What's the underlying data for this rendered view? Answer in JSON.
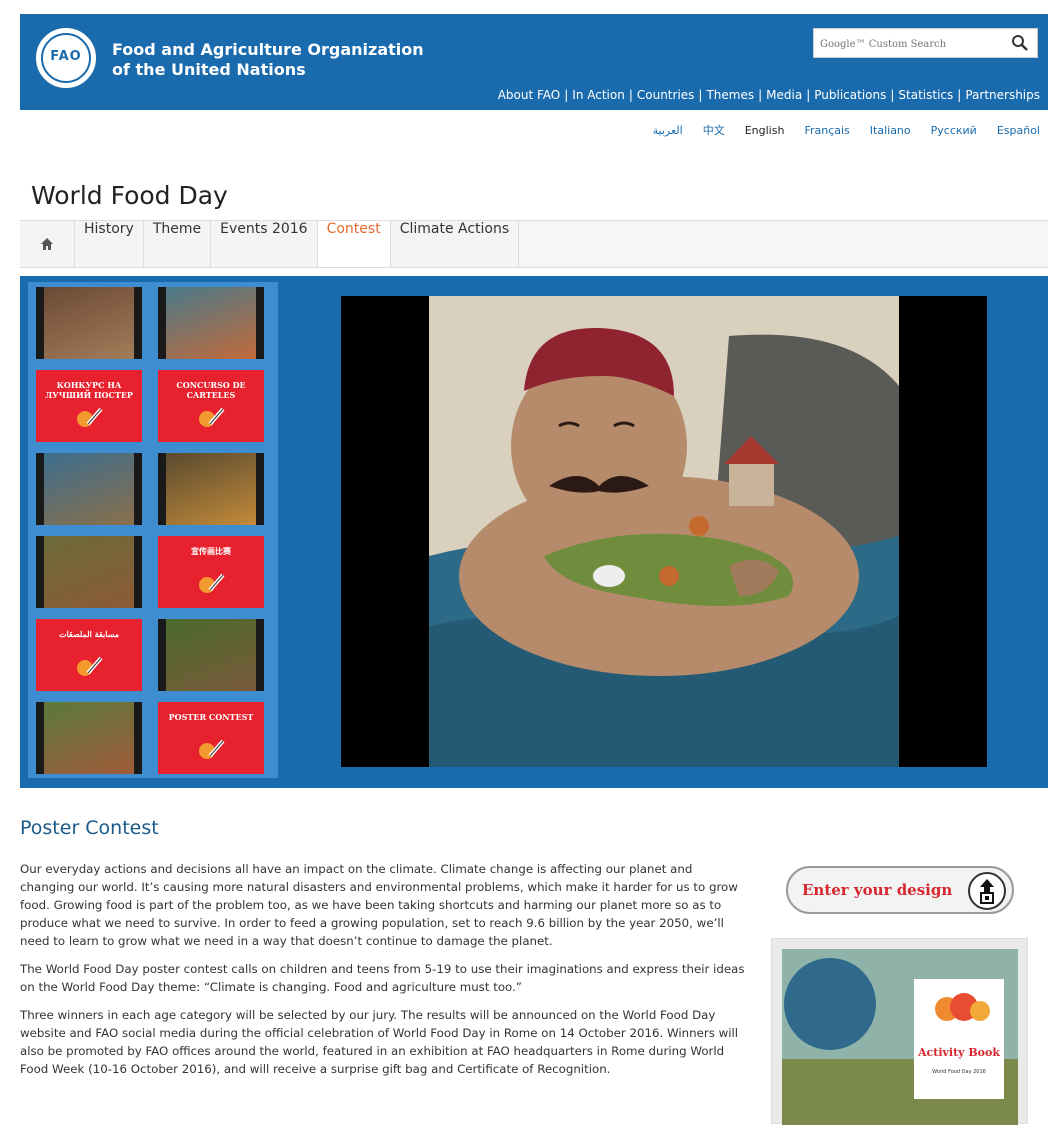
{
  "header": {
    "logo_text": "FAO",
    "org_line1": "Food and Agriculture Organization",
    "org_line2": "of the United Nations",
    "search_placeholder": "Google™ Custom Search",
    "nav": [
      "About FAO",
      "In Action",
      "Countries",
      "Themes",
      "Media",
      "Publications",
      "Statistics",
      "Partnerships"
    ]
  },
  "languages": [
    {
      "label": "العربية",
      "active": false
    },
    {
      "label": "中文",
      "active": false
    },
    {
      "label": "English",
      "active": true
    },
    {
      "label": "Français",
      "active": false
    },
    {
      "label": "Italiano",
      "active": false
    },
    {
      "label": "Русский",
      "active": false
    },
    {
      "label": "Español",
      "active": false
    }
  ],
  "page_title": "World Food Day",
  "subnav": {
    "home_icon": "home-icon",
    "tabs": [
      {
        "label": "History",
        "active": false
      },
      {
        "label": "Theme",
        "active": false
      },
      {
        "label": "Events 2016",
        "active": false
      },
      {
        "label": "Contest",
        "active": true
      },
      {
        "label": "Climate Actions",
        "active": false
      }
    ]
  },
  "gallery": {
    "thumbs": [
      {
        "type": "image"
      },
      {
        "type": "image"
      },
      {
        "type": "red",
        "label": "КОНКУРС НА ЛУЧШИЙ ПОСТЕР"
      },
      {
        "type": "red",
        "label": "CONCURSO DE CARTELES"
      },
      {
        "type": "image"
      },
      {
        "type": "image"
      },
      {
        "type": "image"
      },
      {
        "type": "red",
        "label": "宣传画比赛"
      },
      {
        "type": "red",
        "label": "مسابقة الملصقات"
      },
      {
        "type": "image"
      },
      {
        "type": "image"
      },
      {
        "type": "red",
        "label": "POSTER CONTEST"
      }
    ]
  },
  "section_title": "Poster Contest",
  "paragraphs": [
    "Our everyday actions and decisions all have an impact on the climate. Climate change is affecting our planet and changing our world. It’s causing more natural disasters and environmental problems, which make it harder for us to grow food. Growing food is part of the problem too, as we have been taking shortcuts and harming our planet more so as to produce what we need to survive. In order to feed a growing population, set to reach 9.6 billion by the year 2050, we’ll need to learn to grow what we need in a way that doesn’t continue to damage the planet.",
    "The World Food Day poster contest calls on children and teens from 5-19 to use their imaginations and express their ideas on the World Food Day theme: “Climate is changing. Food and agriculture must too.”",
    "Three winners in each age category will be selected by our jury. The results will be announced on the World Food Day website and FAO social media during the official celebration of World Food Day in Rome on 14 October 2016. Winners will also be promoted by FAO offices around the world, featured in an exhibition at FAO headquarters in Rome during World Food Week (10-16 October 2016), and will receive a surprise gift bag and Certificate of Recognition."
  ],
  "enter_button": "Enter your design",
  "activity_book": {
    "title": "Activity Book",
    "subtitle": "World Food Day 2016"
  },
  "colors": {
    "brand_blue": "#1a6bad",
    "active_tab": "#e56b2e",
    "contest_red": "#e8212e"
  }
}
